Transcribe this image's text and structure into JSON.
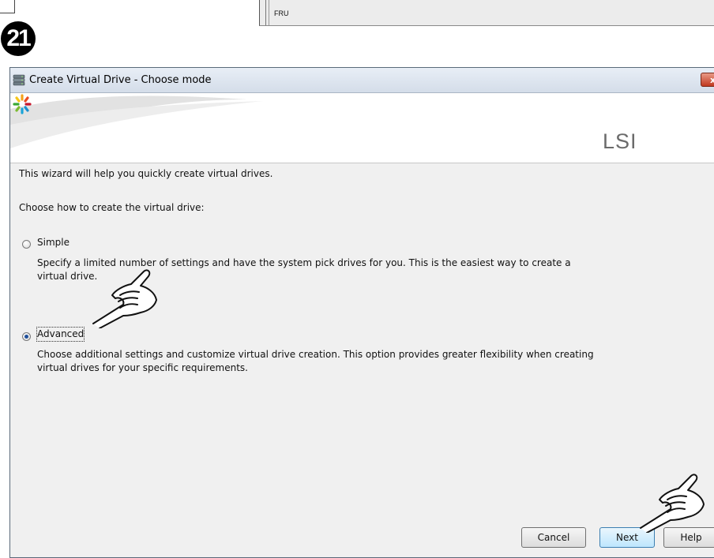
{
  "top_fragment": {
    "label": "FRU"
  },
  "step": {
    "number": "21"
  },
  "dialog": {
    "title": "Create Virtual Drive - Choose mode",
    "close_glyph": "x",
    "logo_text": "LSI",
    "intro": "This wizard will help you quickly create virtual drives.",
    "prompt": "Choose how to create the virtual drive:",
    "options": [
      {
        "label": "Simple",
        "selected": false,
        "description_line1": "Specify a limited number of settings and have the system pick drives for you. This is the easiest way to create a",
        "description_line2": "virtual drive."
      },
      {
        "label": "Advanced",
        "selected": true,
        "description_line1": "Choose additional settings and customize virtual drive creation. This option provides greater flexibility when creating",
        "description_line2": "virtual drives for your specific requirements."
      }
    ],
    "buttons": {
      "cancel": "Cancel",
      "next": "Next",
      "help": "Help"
    }
  },
  "icons": {
    "app": "database-icon",
    "close": "close-icon",
    "logo": "lsi-starburst-icon",
    "pointer": "pointing-hand-icon"
  },
  "colors": {
    "titlebar": "#d4dde9",
    "close_button": "#c0391f",
    "radio_selected": "#1f4f9a",
    "default_button": "#bee6fd"
  }
}
